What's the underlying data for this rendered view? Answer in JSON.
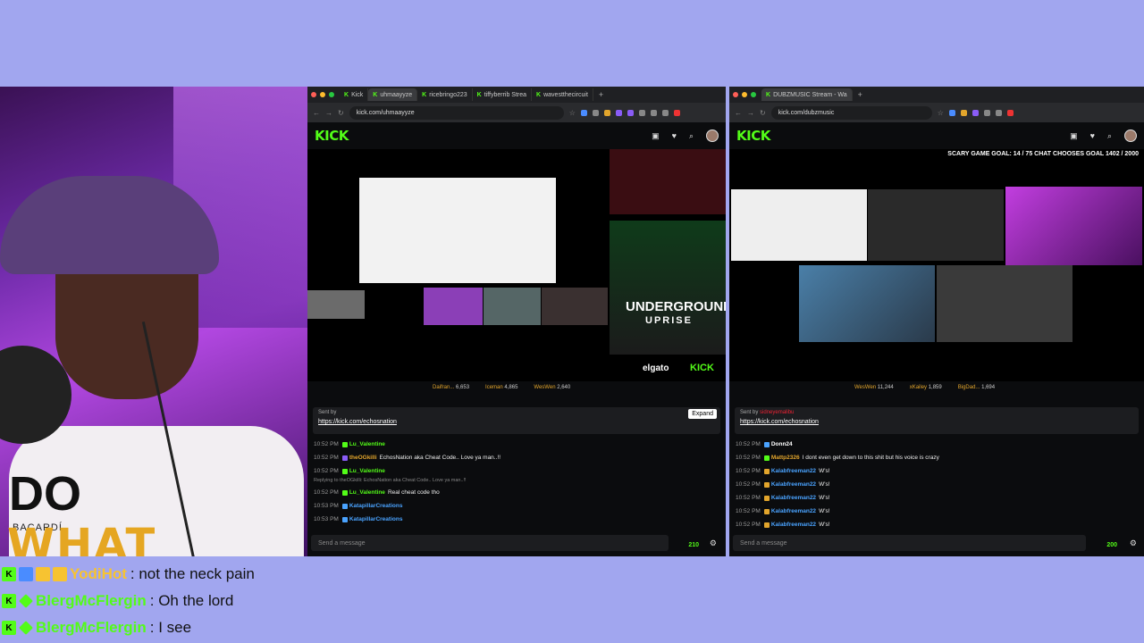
{
  "left_browser": {
    "tabs": [
      "Kick",
      "uhmaayyze",
      "ricebringo223",
      "tiffyberrib Strea",
      "wavestthecircuit"
    ],
    "url": "kick.com/uhmaayyze",
    "logo": "KICK",
    "sponsor_row": [
      {
        "name": "Daifran...",
        "value": "6,653"
      },
      {
        "name": "Iceman",
        "value": "4,865"
      },
      {
        "name": "WesWen",
        "value": "2,640"
      }
    ],
    "pinned_sender": "Sent by",
    "pinned_link": "https://kick.com/echosnation",
    "expand_label": "Expand",
    "messages": [
      {
        "time": "10:52 PM",
        "user": "Lu_Valentine",
        "color": "#53fc18",
        "text": ""
      },
      {
        "time": "10:52 PM",
        "user": "theOGkilli",
        "color": "#e2a52c",
        "text": "EchosNation aka Cheat Code.. Love ya man..!!"
      },
      {
        "time": "10:52 PM",
        "user": "Lu_Valentine",
        "color": "#53fc18",
        "text": ""
      },
      {
        "time": "10:52 PM",
        "user": "Lu_Valentine",
        "color": "#53fc18",
        "text": "Real cheat code tho",
        "reply": "Replying to theOGkilli: EchosNation aka Cheat Code.. Love ya man..!!"
      },
      {
        "time": "10:53 PM",
        "user": "KatapillarCreations",
        "color": "#4aa3ff",
        "text": ""
      },
      {
        "time": "10:53 PM",
        "user": "KatapillarCreations",
        "color": "#4aa3ff",
        "text": ""
      }
    ],
    "send_placeholder": "Send a message",
    "viewer_count": "210",
    "stream_text": {
      "event_title": "UNDERGROUND",
      "event_sub": "UPRISE",
      "elgato": "elgato",
      "kick_small": "KICK"
    }
  },
  "right_browser": {
    "tabs": [
      "DUBZMUSIC Stream - Wa"
    ],
    "url": "kick.com/dubzmusic",
    "logo": "KICK",
    "goal_text": "SCARY GAME GOAL: 14 / 75   CHAT CHOOSES GOAL  1402 / 2000",
    "sponsor_row": [
      {
        "name": "WesWen",
        "value": "11,244"
      },
      {
        "name": "xKailey",
        "value": "1,859"
      },
      {
        "name": "BigDad...",
        "value": "1,694"
      }
    ],
    "pinned_sender": "Sent by",
    "pinned_user": "sidneyemalibu",
    "pinned_link": "https://kick.com/echosnation",
    "messages": [
      {
        "time": "10:52 PM",
        "user": "Donn24",
        "color": "#ffffff",
        "text": ""
      },
      {
        "time": "10:52 PM",
        "user": "Mattp2326",
        "color": "#e2a52c",
        "text": "I dont even get down to this shit but his voice is crazy"
      },
      {
        "time": "10:52 PM",
        "user": "Kalabfreeman22",
        "color": "#4aa3ff",
        "text": "W's!"
      },
      {
        "time": "10:52 PM",
        "user": "Kalabfreeman22",
        "color": "#4aa3ff",
        "text": "W's!"
      },
      {
        "time": "10:52 PM",
        "user": "Kalabfreeman22",
        "color": "#4aa3ff",
        "text": "W's!"
      },
      {
        "time": "10:52 PM",
        "user": "Kalabfreeman22",
        "color": "#4aa3ff",
        "text": "W's!"
      },
      {
        "time": "10:52 PM",
        "user": "Kalabfreeman22",
        "color": "#4aa3ff",
        "text": "W's!"
      }
    ],
    "send_placeholder": "Send a message",
    "viewer_count": "200"
  },
  "overlay_chat": [
    {
      "user": "YodiHot",
      "user_color": "#f7c331",
      "text": ": not the neck pain"
    },
    {
      "user": "BlergMcFlergin",
      "user_color": "#53fc18",
      "text": ": Oh the lord"
    },
    {
      "user": "BlergMcFlergin",
      "user_color": "#53fc18",
      "text": ": I see"
    }
  ],
  "webcam": {
    "shirt_brand": "BACARDÍ",
    "shirt_line1": "DO",
    "shirt_line2": "WHAT"
  },
  "colors": {
    "kick_green": "#53fc18",
    "background": "#a1a6ef"
  }
}
